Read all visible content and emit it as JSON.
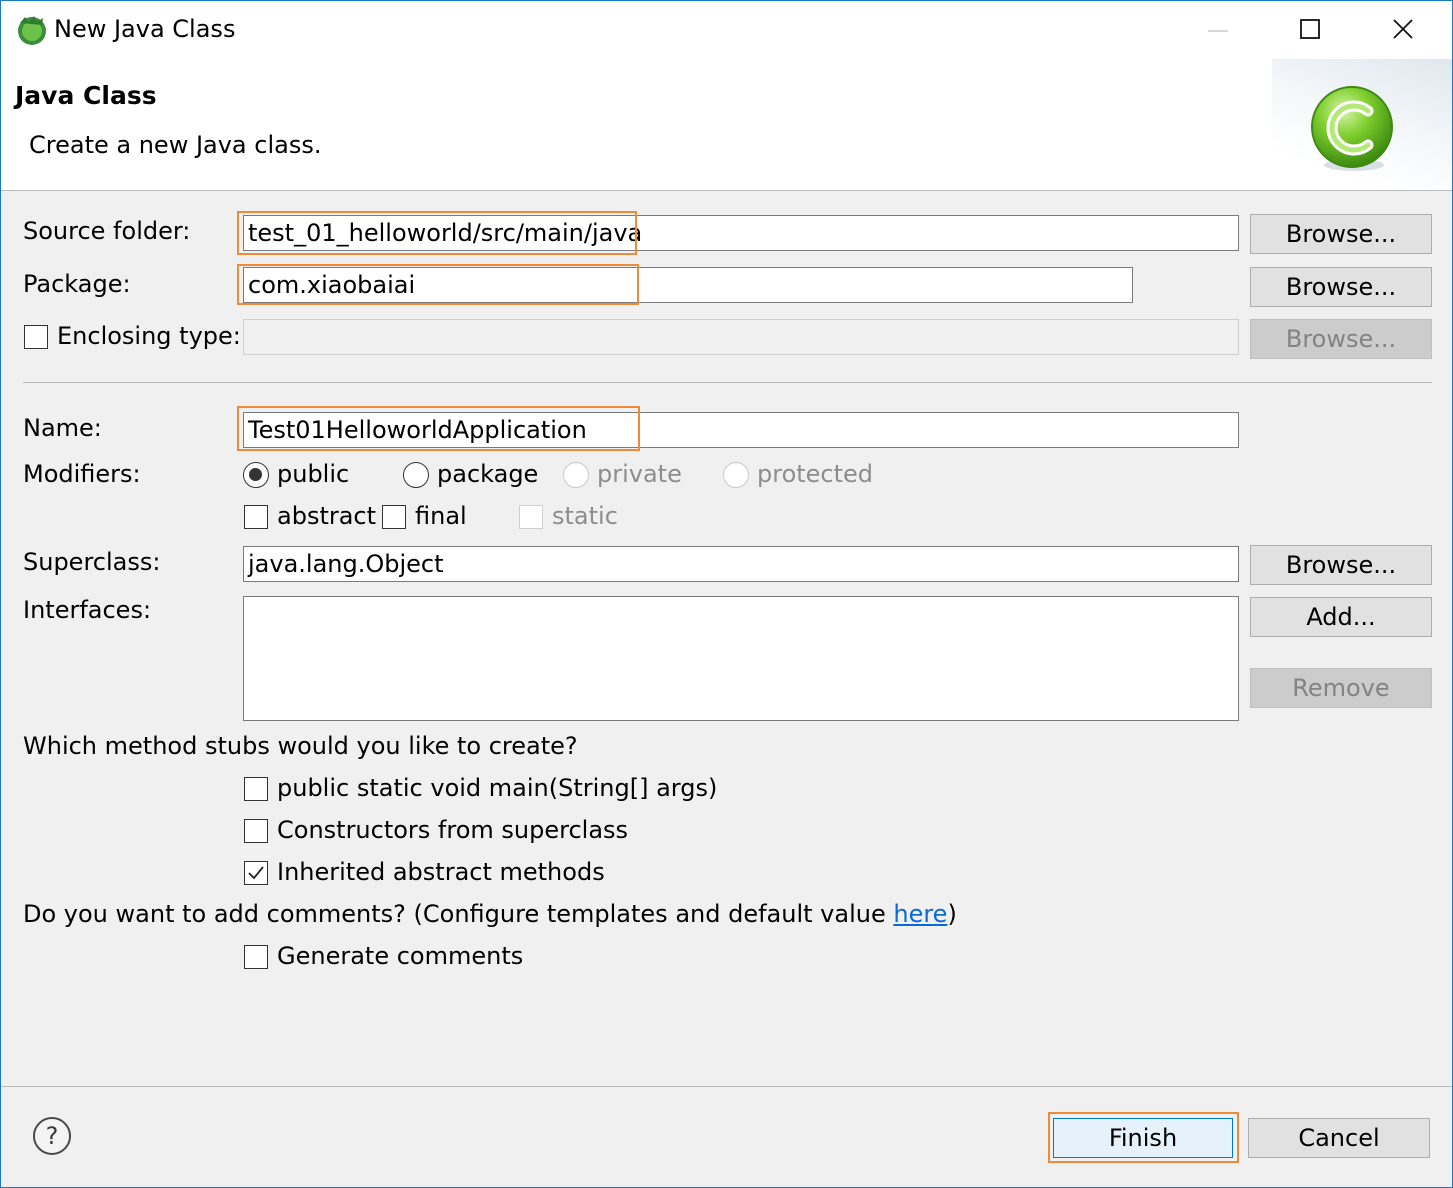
{
  "window": {
    "title": "New Java Class",
    "minimize_icon": "minimize-icon",
    "maximize_icon": "maximize-icon",
    "close_icon": "close-icon"
  },
  "header": {
    "title": "Java Class",
    "description": "Create a new Java class.",
    "icon": "java-class-icon"
  },
  "form": {
    "source_folder_label": "Source folder:",
    "source_folder_value": "test_01_helloworld/src/main/java",
    "package_label": "Package:",
    "package_value": "com.xiaobaiai",
    "enclosing_type_label": "Enclosing type:",
    "enclosing_type_value": "",
    "enclosing_type_checked": false,
    "browse_label": "Browse...",
    "name_label": "Name:",
    "name_value": "Test01HelloworldApplication",
    "modifiers_label": "Modifiers:",
    "modifiers": {
      "public": "public",
      "package": "package",
      "private": "private",
      "protected": "protected",
      "selected": "public",
      "abstract": "abstract",
      "final": "final",
      "static": "static"
    },
    "superclass_label": "Superclass:",
    "superclass_value": "java.lang.Object",
    "interfaces_label": "Interfaces:",
    "add_label": "Add...",
    "remove_label": "Remove",
    "stubs_question": "Which method stubs would you like to create?",
    "stubs": [
      {
        "label": "public static void main(String[] args)",
        "checked": false
      },
      {
        "label": "Constructors from superclass",
        "checked": false
      },
      {
        "label": "Inherited abstract methods",
        "checked": true
      }
    ],
    "comments_question": "Do you want to add comments? (Configure templates and default value ",
    "comments_link": "here",
    "comments_close": ")",
    "generate_comments_label": "Generate comments",
    "generate_comments_checked": false
  },
  "footer": {
    "help_icon": "help-icon",
    "finish_label": "Finish",
    "cancel_label": "Cancel"
  },
  "colors": {
    "highlight": "#ef8a3a",
    "window_border": "#1979ca",
    "link": "#0b6ad6"
  }
}
